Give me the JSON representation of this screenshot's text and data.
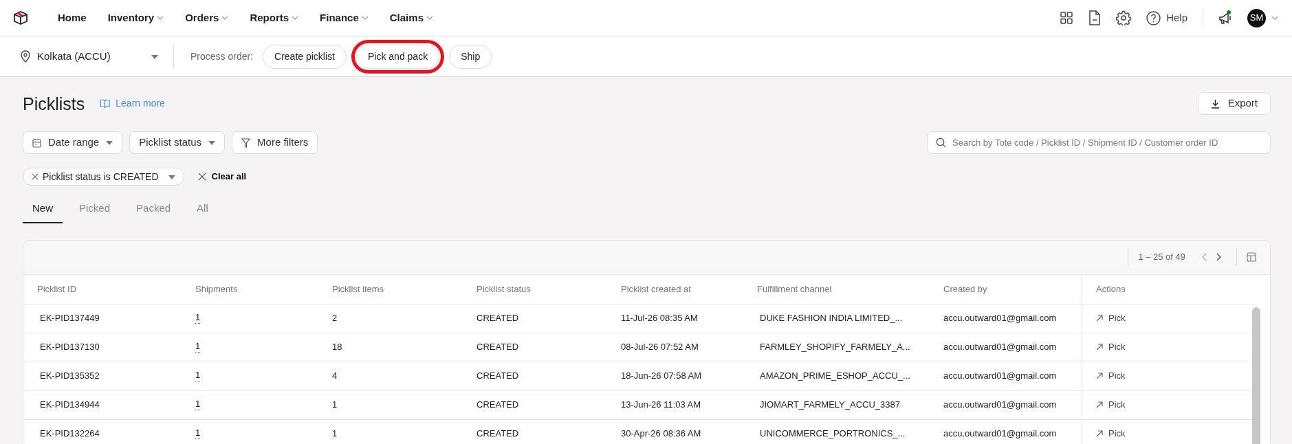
{
  "nav": {
    "items": [
      {
        "label": "Home",
        "dropdown": false
      },
      {
        "label": "Inventory",
        "dropdown": true
      },
      {
        "label": "Orders",
        "dropdown": true
      },
      {
        "label": "Reports",
        "dropdown": true
      },
      {
        "label": "Finance",
        "dropdown": true
      },
      {
        "label": "Claims",
        "dropdown": true
      }
    ],
    "help": "Help",
    "notification_dot": true,
    "avatar": "SM"
  },
  "subbar": {
    "location": "Kolkata (ACCU)",
    "process_label": "Process order:",
    "process_buttons": [
      {
        "label": "Create picklist",
        "highlighted": false
      },
      {
        "label": "Pick and pack",
        "highlighted": true
      },
      {
        "label": "Ship",
        "highlighted": false
      }
    ]
  },
  "page": {
    "title": "Picklists",
    "learn_more": "Learn more",
    "export": "Export"
  },
  "filters": [
    {
      "kind": "date",
      "label": "Date range"
    },
    {
      "kind": "select",
      "label": "Picklist status"
    },
    {
      "kind": "more",
      "label": "More filters"
    }
  ],
  "search": {
    "placeholder": "Search by Tote code / Picklist ID / Shipment ID / Customer order ID"
  },
  "applied_filters": [
    {
      "label": "Picklist status is CREATED"
    }
  ],
  "clear_all": "Clear all",
  "tabs": [
    {
      "label": "New",
      "selected": true
    },
    {
      "label": "Picked",
      "selected": false
    },
    {
      "label": "Packed",
      "selected": false
    },
    {
      "label": "All",
      "selected": false
    }
  ],
  "table": {
    "pagination": "1 – 25 of 49",
    "columns": [
      "Picklist ID",
      "Shipments",
      "Picklist items",
      "Picklist status",
      "Picklist created at",
      "Fulfillment channel",
      "Created by",
      "Actions"
    ],
    "rows": [
      {
        "picklist_id": "EK-PID137449",
        "shipments": "1",
        "items": "2",
        "status": "CREATED",
        "created_at": "11-Jul-26 08:35 AM",
        "channel": "DUKE FASHION INDIA LIMITED_...",
        "created_by": "accu.outward01@gmail.com",
        "action": "Pick"
      },
      {
        "picklist_id": "EK-PID137130",
        "shipments": "1",
        "items": "18",
        "status": "CREATED",
        "created_at": "08-Jul-26 07:52 AM",
        "channel": "FARMLEY_SHOPIFY_FARMELY_A...",
        "created_by": "accu.outward01@gmail.com",
        "action": "Pick"
      },
      {
        "picklist_id": "EK-PID135352",
        "shipments": "1",
        "items": "4",
        "status": "CREATED",
        "created_at": "18-Jun-26 07:58 AM",
        "channel": "AMAZON_PRIME_ESHOP_ACCU_...",
        "created_by": "accu.outward01@gmail.com",
        "action": "Pick"
      },
      {
        "picklist_id": "EK-PID134944",
        "shipments": "1",
        "items": "1",
        "status": "CREATED",
        "created_at": "13-Jun-26 11:03 AM",
        "channel": "JIOMART_FARMELY_ACCU_3387",
        "created_by": "accu.outward01@gmail.com",
        "action": "Pick"
      },
      {
        "picklist_id": "EK-PID132264",
        "shipments": "1",
        "items": "1",
        "status": "CREATED",
        "created_at": "30-Apr-26 08:36 AM",
        "channel": "UNICOMMERCE_PORTRONICS_...",
        "created_by": "accu.outward01@gmail.com",
        "action": "Pick"
      }
    ]
  }
}
